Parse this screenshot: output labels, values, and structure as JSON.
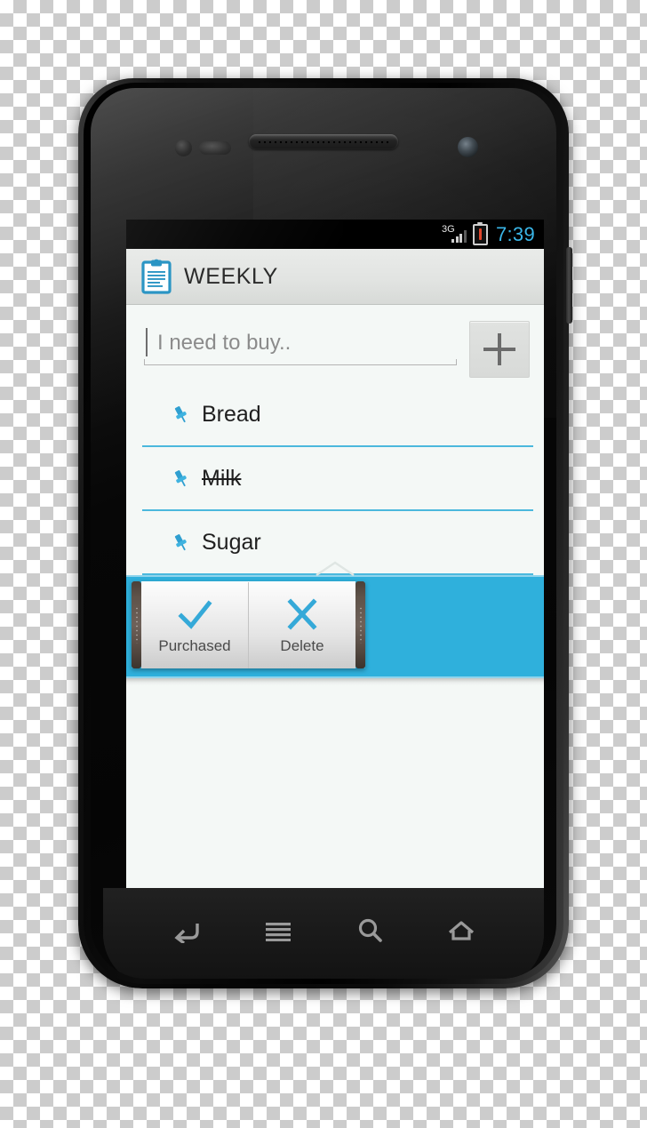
{
  "device": {
    "name": "android-smartphone",
    "hardware": {
      "earpiece": "earpiece-speaker",
      "front_camera": "front-camera",
      "proximity_sensor": "proximity-sensor",
      "power_button": "power-button"
    }
  },
  "status_bar": {
    "network_label": "3G",
    "signal_bars": 3,
    "signal_bars_total": 4,
    "battery_state": "warning",
    "time": "7:39",
    "time_color": "#3ab6e8"
  },
  "app_header": {
    "icon": "clipboard-icon",
    "title": "WEEKLY",
    "background": "#e2e4e2"
  },
  "input": {
    "placeholder": "I need to buy..",
    "value": "",
    "add_button_label": "+",
    "add_button_icon": "plus-icon"
  },
  "list": {
    "items": [
      {
        "label": "Bread",
        "icon": "pin-icon",
        "purchased": false
      },
      {
        "label": "Milk",
        "icon": "pin-icon",
        "purchased": true
      },
      {
        "label": "Sugar",
        "icon": "pin-icon",
        "purchased": false
      },
      {
        "label": "",
        "icon": "pin-icon",
        "purchased": false
      }
    ],
    "selected_index": 3,
    "separator_color": "#4bb8dd",
    "selection_color": "#2fb0dc",
    "background": "#f4f8f6"
  },
  "context_menu": {
    "items": [
      {
        "label": "Purchased",
        "icon": "check-icon"
      },
      {
        "label": "Delete",
        "icon": "cross-icon"
      }
    ],
    "icon_color": "#35a9d8"
  },
  "nav_bar": {
    "buttons": [
      {
        "name": "back-button",
        "icon": "back-arrow-icon"
      },
      {
        "name": "menu-button",
        "icon": "menu-lines-icon"
      },
      {
        "name": "search-button",
        "icon": "search-magnifier-icon"
      },
      {
        "name": "home-button",
        "icon": "home-icon"
      }
    ]
  },
  "theme": {
    "accent": "#2fb0dc",
    "accent_light": "#4bb8dd",
    "screen_bg": "#f4f8f6",
    "header_bg": "#e2e4e2",
    "text": "#1f1f1f"
  }
}
